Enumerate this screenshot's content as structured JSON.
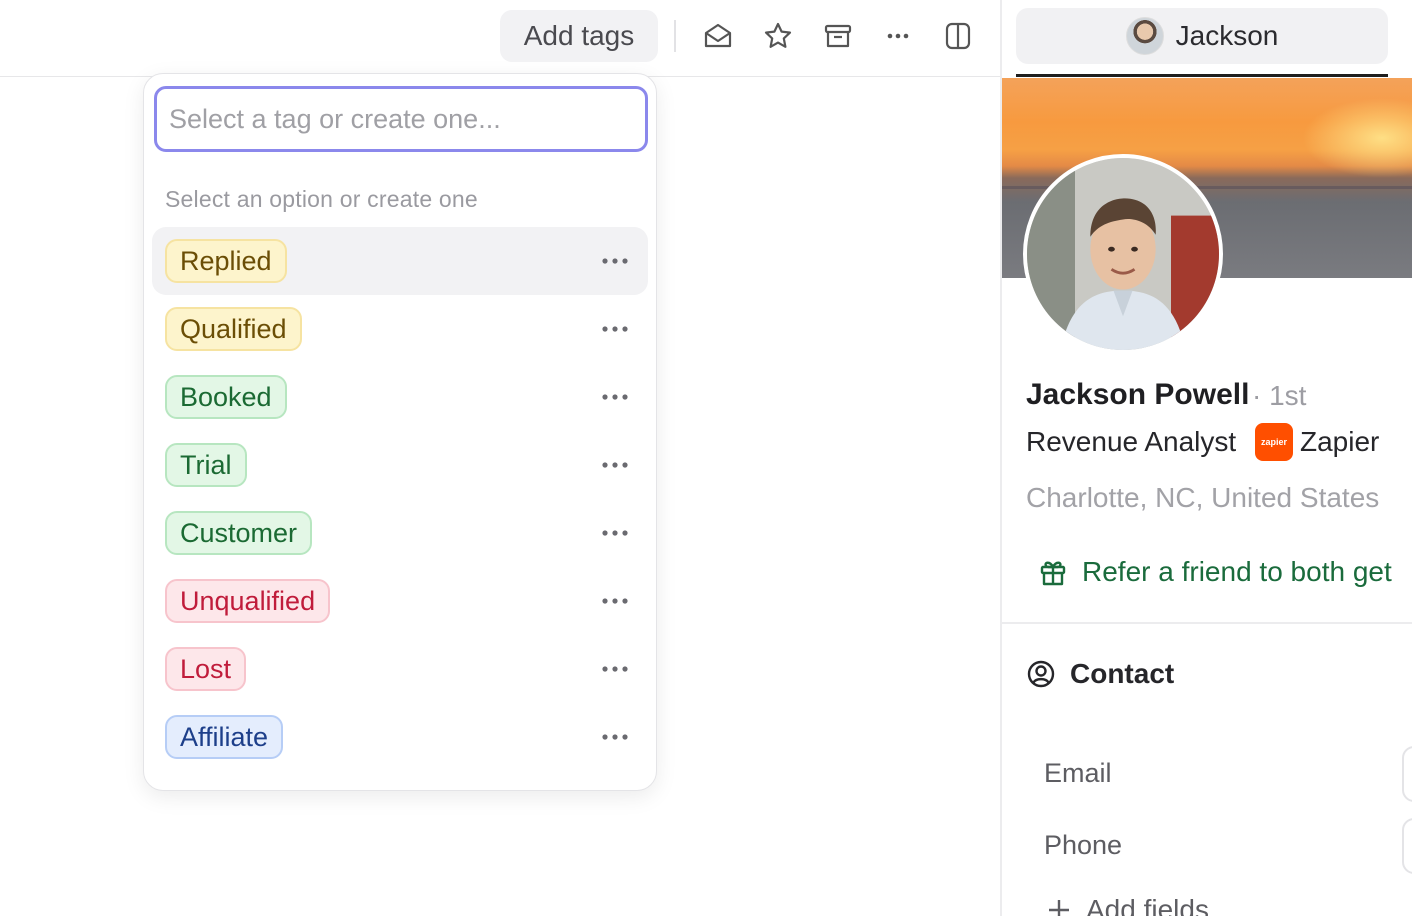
{
  "toolbar": {
    "add_tags_label": "Add tags",
    "icons": [
      "mail-open-icon",
      "star-icon",
      "archive-icon",
      "more-icon",
      "panel-toggle-icon"
    ]
  },
  "tag_dropdown": {
    "input_placeholder": "Select a tag or create one...",
    "input_value": "",
    "hint": "Select an option or create one",
    "tags": [
      {
        "label": "Replied",
        "color": "yellow",
        "hovered": true
      },
      {
        "label": "Qualified",
        "color": "yellow"
      },
      {
        "label": "Booked",
        "color": "green"
      },
      {
        "label": "Trial",
        "color": "green"
      },
      {
        "label": "Customer",
        "color": "green"
      },
      {
        "label": "Unqualified",
        "color": "red"
      },
      {
        "label": "Lost",
        "color": "red"
      },
      {
        "label": "Affiliate",
        "color": "blue"
      }
    ]
  },
  "profile_panel": {
    "tab_label": "Jackson",
    "name": "Jackson Powell",
    "degree": "· 1st",
    "title": "Revenue Analyst",
    "company_logo_text": "zapier",
    "company": "Zapier",
    "location": "Charlotte, NC, United States",
    "refer_text": "Refer a friend to both get",
    "contact_heading": "Contact",
    "fields": [
      {
        "label": "Email"
      },
      {
        "label": "Phone"
      }
    ],
    "add_fields_label": "Add fields"
  },
  "colors": {
    "accent_input_border": "#8b88ec",
    "refer_green": "#1a6b3c",
    "zapier_orange": "#ff4f00"
  }
}
